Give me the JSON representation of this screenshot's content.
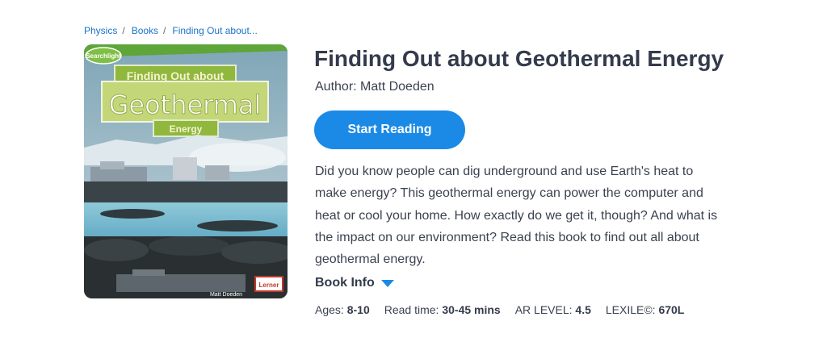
{
  "breadcrumb": {
    "items": [
      "Physics",
      "Books",
      "Finding Out about..."
    ],
    "separator": "/"
  },
  "cover": {
    "series_badge": "Searchlight",
    "title_top": "Finding Out about",
    "title_main": "Geothermal",
    "title_bottom": "Energy",
    "author": "Matt Doeden",
    "publisher": "Lerner"
  },
  "book": {
    "title": "Finding Out about Geothermal Energy",
    "author_label": "Author: Matt Doeden",
    "start_button": "Start Reading",
    "description": "Did you know people can dig underground and use Earth's heat to make energy? This geothermal energy can power the computer and heat or cool your home. How exactly do we get it, though? And what is the impact on our environment? Read this book to find out all about geothermal energy.",
    "info_label": "Book Info",
    "info_icon": "caret-down-icon"
  },
  "meta": {
    "ages_label": "Ages:",
    "ages_value": "8-10",
    "readtime_label": "Read time:",
    "readtime_value": "30-45 mins",
    "ar_label": "AR LEVEL:",
    "ar_value": "4.5",
    "lexile_label": "LEXILE©:",
    "lexile_value": "670L"
  },
  "colors": {
    "accent": "#1a8ae6",
    "link": "#1a73c7",
    "title": "#333b4c"
  }
}
